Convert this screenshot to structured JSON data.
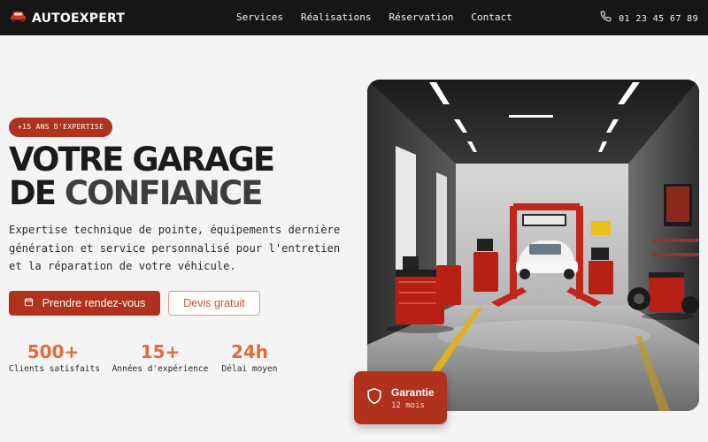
{
  "brand": {
    "name": "AUTOEXPERT",
    "icon": "car-icon"
  },
  "nav": {
    "links": [
      {
        "label": "Services"
      },
      {
        "label": "Réalisations"
      },
      {
        "label": "Réservation"
      },
      {
        "label": "Contact"
      }
    ],
    "phone": {
      "icon": "phone-icon",
      "number": "01 23 45 67 89"
    }
  },
  "hero": {
    "badge": "+15 ANS D'EXPERTISE",
    "title_line1": "VOTRE GARAGE",
    "title_line2_a": "DE ",
    "title_line2_b": "CONFIANCE",
    "description": "Expertise technique de pointe, équipements dernière génération et service personnalisé pour l'entretien et la réparation de votre véhicule.",
    "primary_cta": {
      "label": "Prendre rendez-vous",
      "icon": "calendar-icon"
    },
    "secondary_cta": {
      "label": "Devis gratuit"
    },
    "stats": [
      {
        "value": "500+",
        "label": "Clients satisfaits"
      },
      {
        "value": "15+",
        "label": "Années d'expérience"
      },
      {
        "value": "24h",
        "label": "Délai moyen"
      }
    ],
    "image": {
      "subject": "garage workshop with car on lift"
    },
    "guarantee": {
      "icon": "shield-icon",
      "title": "Garantie",
      "subtitle": "12 mois"
    }
  },
  "colors": {
    "accent": "#b0321c",
    "accent_light": "#e36b3a",
    "nav_bg": "#161616",
    "page_bg": "#f4f4f4"
  }
}
